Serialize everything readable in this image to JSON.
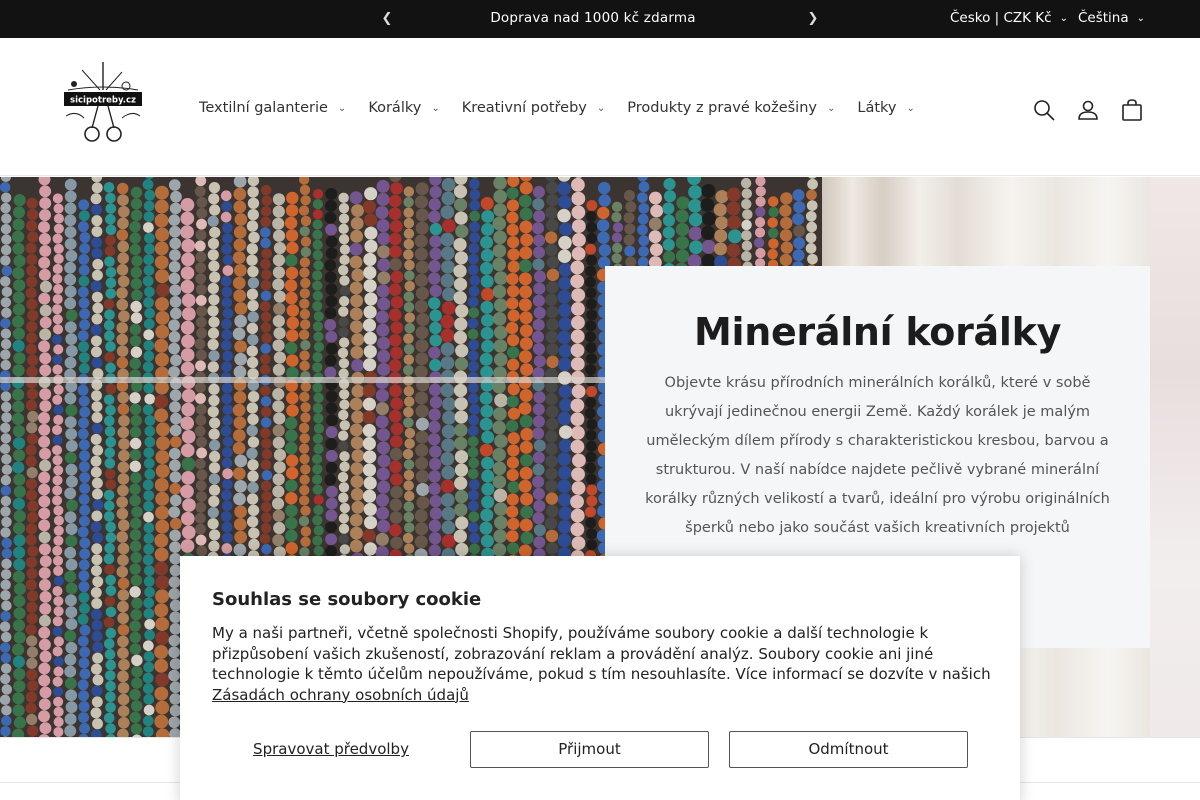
{
  "announcement": {
    "message": "Doprava nad 1000 kč zdarma",
    "country_selector": "Česko | CZK Kč",
    "language_selector": "Čeština"
  },
  "header": {
    "logo_text": "sicipotreby.cz",
    "nav": [
      {
        "label": "Textilní galanterie"
      },
      {
        "label": "Korálky"
      },
      {
        "label": "Kreativní potřeby"
      },
      {
        "label": "Produkty z pravé kožešiny"
      },
      {
        "label": "Látky"
      }
    ],
    "icons": [
      "search-icon",
      "account-icon",
      "cart-icon"
    ]
  },
  "hero": {
    "title": "Minerální korálky",
    "text": "Objevte krásu přírodních minerálních korálků, které v sobě ukrývají jedinečnou energii Země. Každý korálek je malým uměleckým dílem přírody s charakteristickou kresbou, barvou a strukturou. V naší nabídce najdete pečlivě vybrané minerální korálky různých velikostí a tvarů, ideální pro výrobu originálních šperků nebo jako součást vašich kreativních projektů"
  },
  "cookie": {
    "title": "Souhlas se soubory cookie",
    "body": "My a naši partneři, včetně společnosti Shopify, používáme soubory cookie a další technologie k přizpůsobení vašich zkušeností, zobrazování reklam a provádění analýz. Soubory cookie ani jiné technologie k těmto účelům nepoužíváme, pokud s tím nesouhlasíte. Více informací se dozvíte v našich",
    "link": "Zásadách ochrany osobních údajů",
    "manage": "Spravovat předvolby",
    "accept": "Přijmout",
    "decline": "Odmítnout"
  },
  "colors": {
    "announcement_bg": "#121212",
    "hero_card_bg": "#f5f6f8",
    "text": "#222222"
  }
}
